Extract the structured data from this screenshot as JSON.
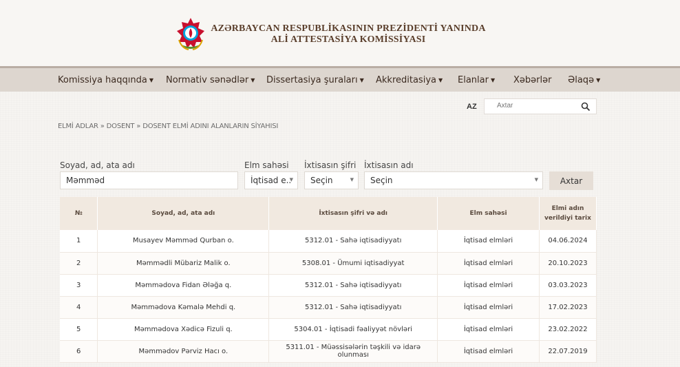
{
  "header": {
    "title_line1": "AZƏRBAYCAN RESPUBLİKASININ PREZİDENTİ YANINDA",
    "title_line2": "ALİ ATTESTASİYA KOMİSSİYASI",
    "emblem_icon": "azerbaijan-emblem-icon"
  },
  "nav": {
    "items": [
      {
        "label": "Komissiya haqqında",
        "dropdown": true
      },
      {
        "label": "Normativ sənədlər",
        "dropdown": true
      },
      {
        "label": "Dissertasiya şuraları",
        "dropdown": true
      },
      {
        "label": "Akkreditasiya",
        "dropdown": true
      },
      {
        "label": "Elanlar",
        "dropdown": true
      },
      {
        "label": "Xəbərlər",
        "dropdown": false
      },
      {
        "label": "Əlaqə",
        "dropdown": true
      }
    ]
  },
  "lang": "AZ",
  "search": {
    "placeholder": "Axtar",
    "icon": "search-icon"
  },
  "breadcrumb": {
    "items": [
      "ELMİ ADLAR",
      "DOSENT",
      "DOSENT ELMİ ADINI ALANLARIN SİYAHISI"
    ],
    "separator": "»"
  },
  "filter": {
    "name_label": "Soyad, ad, ata adı",
    "name_value": "Məmməd",
    "field_label": "Elm sahəsi",
    "field_value": "İqtisad e...",
    "code_label": "İxtisasın şifri",
    "code_value": "Seçin",
    "spec_label": "İxtisasın adı",
    "spec_value": "Seçin",
    "submit_label": "Axtar"
  },
  "table": {
    "headers": [
      "№",
      "Soyad, ad, ata adı",
      "İxtisasın şifri və adı",
      "Elm sahəsi",
      "Elmi adın verildiyi tarix"
    ],
    "rows": [
      [
        "1",
        "Musayev Məmməd Qurban o.",
        "5312.01 - Sahə iqtisadiyyatı",
        "İqtisad elmləri",
        "04.06.2024"
      ],
      [
        "2",
        "Məmmədli Mübariz Malik o.",
        "5308.01 - Ümumi iqtisadiyyat",
        "İqtisad elmləri",
        "20.10.2023"
      ],
      [
        "3",
        "Məmmədova Fidan Ələğa q.",
        "5312.01 - Sahə iqtisadiyyatı",
        "İqtisad elmləri",
        "03.03.2023"
      ],
      [
        "4",
        "Məmmədova Kəmalə Mehdi q.",
        "5312.01 - Sahə iqtisadiyyatı",
        "İqtisad elmləri",
        "17.02.2023"
      ],
      [
        "5",
        "Məmmədova Xədicə Fizuli q.",
        "5304.01 - İqtisadi fəaliyyət növləri",
        "İqtisad elmləri",
        "23.02.2022"
      ],
      [
        "6",
        "Məmmədov Pərviz Hacı o.",
        "5311.01 - Müəssisələrin təşkili və idarə olunması",
        "İqtisad elmləri",
        "22.07.2019"
      ]
    ]
  },
  "colors": {
    "brand": "#5a3e2b",
    "nav_bg": "#ddd6cf",
    "table_header_bg": "#f1e9e0"
  }
}
